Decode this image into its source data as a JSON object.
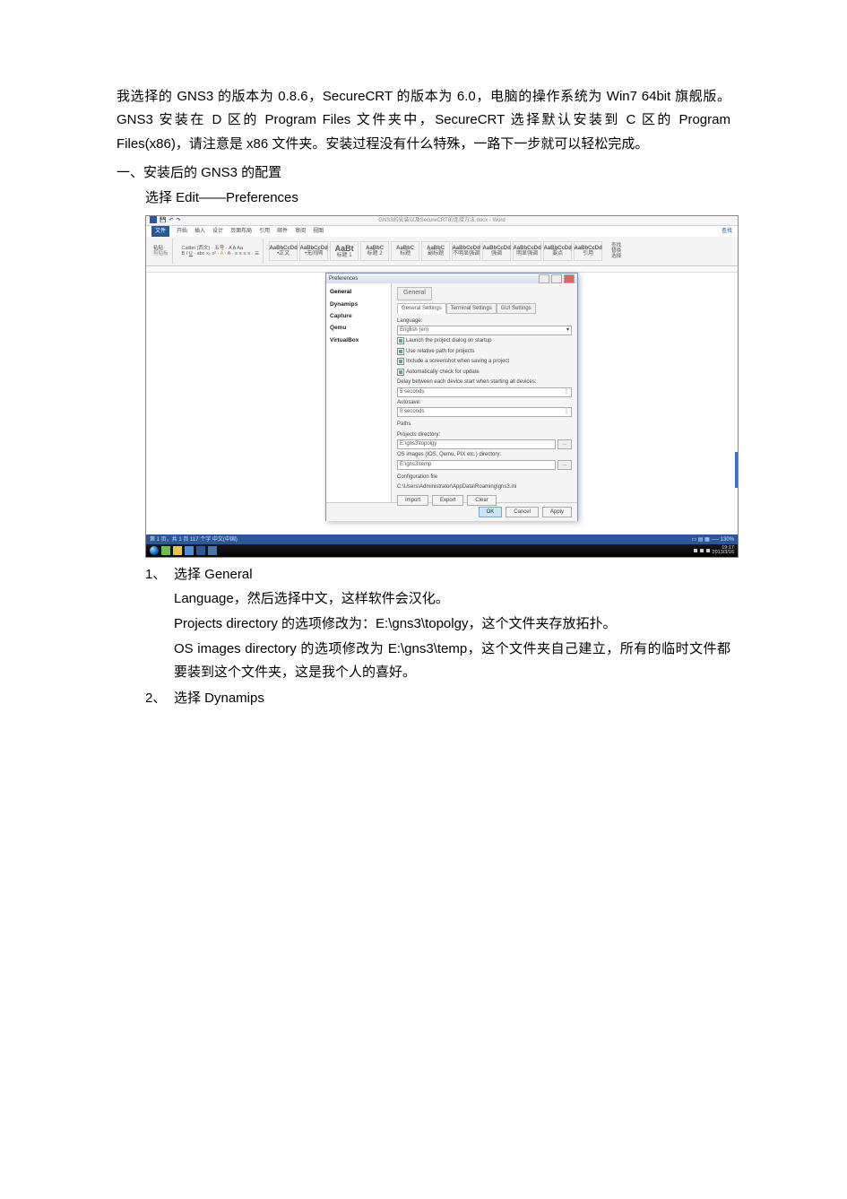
{
  "doc": {
    "p1": "我选择的 GNS3 的版本为 0.8.6，SecureCRT 的版本为 6.0，电脑的操作系统为 Win7  64bit 旗舰版。GNS3 安装在 D 区的 Program  Files 文件夹中，SecureCRT 选择默认安装到 C 区的 Program Files(x86)，请注意是 x86 文件夹。安装过程没有什么特殊，一路下一步就可以轻松完成。",
    "h1": "一、安装后的 GNS3 的配置",
    "h1_sub": "选择 Edit——Preferences",
    "item1_num": "1、",
    "item1_title": "选择 General",
    "item1_l1": "Language，然后选择中文，这样软件会汉化。",
    "item1_l2": "Projects  directory 的选项修改为：E:\\gns3\\topolgy，这个文件夹存放拓扑。",
    "item1_l3": "OS  images  directory 的选项修改为 E:\\gns3\\temp，这个文件夹自己建立，所有的临时文件都要装到这个文件夹，这是我个人的喜好。",
    "item2_num": "2、",
    "item2_title": "选择 Dynamips"
  },
  "shot": {
    "word": {
      "title": "GNS3的安装以及SecureCRT的连接方法.docx - Word",
      "menu": {
        "file": "文件",
        "items": [
          "开始",
          "插入",
          "设计",
          "页面布局",
          "引用",
          "邮件",
          "审阅",
          "视图"
        ]
      },
      "search": "查找",
      "clipboard": {
        "paste": "粘贴",
        "label": "剪贴板"
      },
      "font_name": "Calibri (西文)",
      "font_size": "五号",
      "styles": [
        "AaBbCcDd",
        "AaBbCcDd",
        "AaBt",
        "AaBbC",
        "AaBbC",
        "AaBbC",
        "AaBbCcDd",
        "AaBbCcDd",
        "AaBbCcDd",
        "AaBbCcDd",
        "AaBbCcDd"
      ],
      "style_names": [
        "•正文",
        "•无间隔",
        "标题 1",
        "标题 2",
        "标题",
        "副标题",
        "不明显强调",
        "强调",
        "明显强调",
        "要点",
        "引用"
      ],
      "editing": {
        "find": "查找",
        "replace": "替换",
        "select": "选择"
      },
      "status_left": "第 1 页，共 1 页   117 个字   中文(中国)",
      "status_right": "130%",
      "taskbar_time": "19:17",
      "taskbar_date": "2013/3/16"
    },
    "pref": {
      "title": "Preferences",
      "side": [
        "General",
        "Dynamips",
        "Capture",
        "Qemu",
        "VirtualBox"
      ],
      "section": "General",
      "tabs": [
        "General Settings",
        "Terminal Settings",
        "GUI Settings"
      ],
      "lang_label": "Language:",
      "lang_value": "English (en)",
      "chk1": "Launch the project dialog on startup",
      "chk2": "Use relative path for projects",
      "chk3": "Include a screenshot when saving a project",
      "chk4": "Automatically check for update",
      "delay_label": "Delay between each device start when starting all devices:",
      "delay_value": "5 seconds",
      "autosave_label": "Autosave:",
      "autosave_value": "0 seconds",
      "paths_header": "Paths",
      "proj_dir_label": "Projects directory:",
      "proj_dir_value": "E:\\gns3\\topolgy",
      "img_dir_label": "OS images (IOS, Qemu, PIX etc.) directory:",
      "img_dir_value": "E:\\gns3\\temp",
      "conf_header": "Configuration file",
      "conf_value": "C:\\Users\\Administrator\\AppData\\Roaming\\gns3.ini",
      "btn_import": "Import",
      "btn_export": "Export",
      "btn_clear": "Clear",
      "btn_ok": "OK",
      "btn_cancel": "Cancel",
      "btn_apply": "Apply",
      "browse": "..."
    }
  }
}
